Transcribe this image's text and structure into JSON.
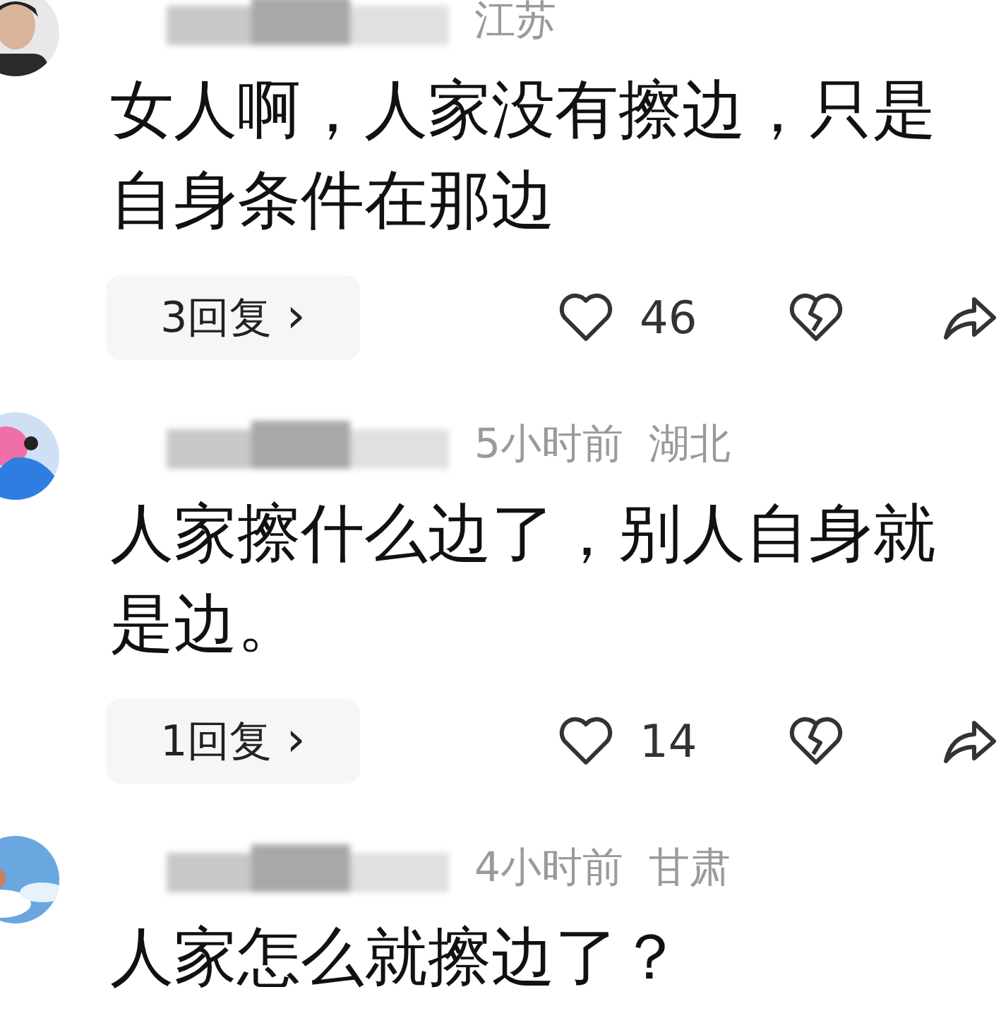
{
  "comments": [
    {
      "location": "江苏",
      "text": "女人啊，人家没有擦边，只是自身条件在那边",
      "replies": "3回复",
      "chevron": "›",
      "likes": "46"
    },
    {
      "time": "5小时前",
      "location": "湖北",
      "text": "人家擦什么边了，别人自身就是边。",
      "replies": "1回复",
      "chevron": "›",
      "likes": "14"
    },
    {
      "time": "4小时前",
      "location": "甘肃",
      "text": "人家怎么就擦边了？"
    }
  ]
}
